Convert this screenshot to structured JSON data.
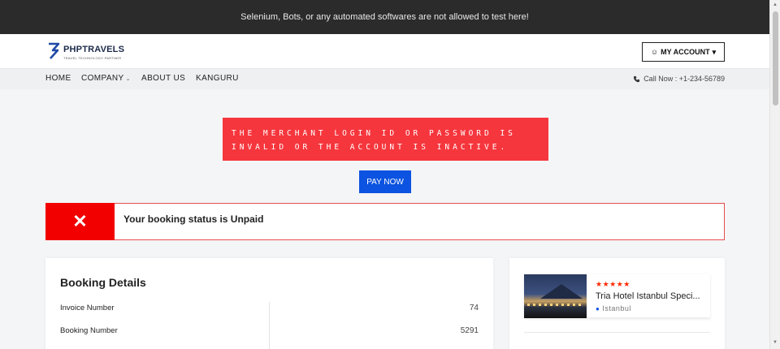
{
  "notice": "Selenium, Bots, or any automated softwares are not allowed to test here!",
  "brand": {
    "name": "PHPTRAVELS",
    "tagline": "TRAVEL TECHNOLOGY PARTNER"
  },
  "account": {
    "label": "MY ACCOUNT"
  },
  "nav": {
    "items": [
      "HOME",
      "COMPANY",
      "ABOUT US",
      "KANGURU"
    ],
    "call": "Call Now : +1-234-56789"
  },
  "error": {
    "message": "THE MERCHANT LOGIN ID OR PASSWORD IS INVALID OR THE ACCOUNT IS INACTIVE."
  },
  "pay": {
    "label": "PAY NOW"
  },
  "status": {
    "text": "Your booking status is Unpaid"
  },
  "booking": {
    "title": "Booking Details",
    "rows": [
      {
        "label": "Invoice Number",
        "value": "74"
      },
      {
        "label": "Booking Number",
        "value": "5291"
      }
    ]
  },
  "hotel": {
    "stars": "★★★★★",
    "name": "Tria Hotel Istanbul Speci...",
    "location": "Istanbul"
  },
  "colors": {
    "error": "#f6363d",
    "primary": "#0b53e0",
    "status": "#f20000",
    "topbar": "#2b2b2b"
  }
}
